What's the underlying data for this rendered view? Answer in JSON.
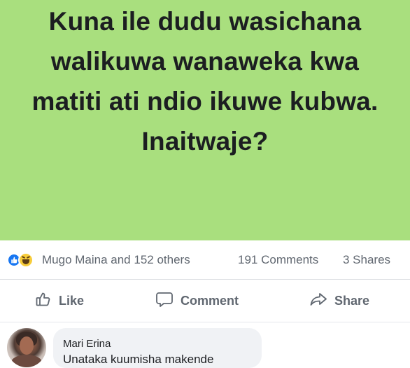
{
  "post": {
    "text": "Kuna ile dudu wasichana walikuwa wanaweka kwa matiti ati ndio ikuwe kubwa. Inaitwaje?",
    "background_color": "#a9df7e"
  },
  "stats": {
    "reactions": [
      "like",
      "haha"
    ],
    "reactors_text": "Mugo Maina and 152 others",
    "comments_text": "191 Comments",
    "shares_text": "3 Shares"
  },
  "actions": {
    "like_label": "Like",
    "comment_label": "Comment",
    "share_label": "Share"
  },
  "comment": {
    "author": "Mari Erina",
    "text": "Unataka kuumisha makende"
  }
}
